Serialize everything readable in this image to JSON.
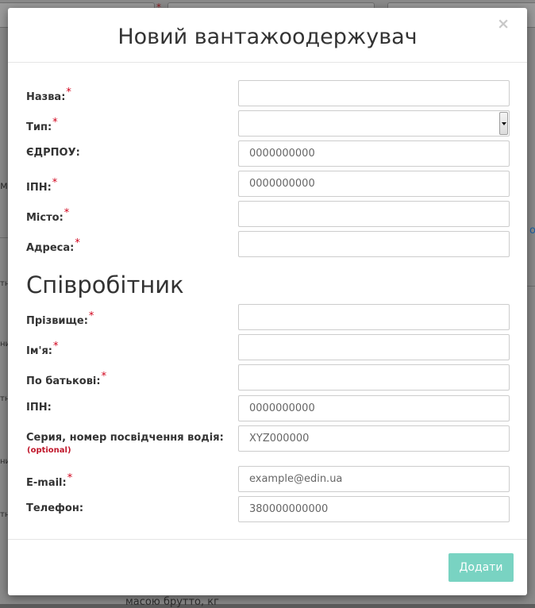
{
  "background": {
    "fragments": [
      "м",
      "о",
      "тн",
      "ни",
      "тн",
      "ни",
      "тн"
    ],
    "footer_text": "масою брутто, кг"
  },
  "modal": {
    "title": "Новий вантажоодержувач",
    "close_label": "×",
    "required_mark": "*",
    "fields": [
      {
        "label": "Назва:",
        "required": true,
        "value": "",
        "placeholder": ""
      },
      {
        "label": "Тип:",
        "required": true,
        "value": "",
        "placeholder": ""
      },
      {
        "label": "ЄДРПОУ:",
        "required": false,
        "value": "",
        "placeholder": "0000000000"
      },
      {
        "label": "ІПН:",
        "required": true,
        "value": "",
        "placeholder": "0000000000"
      },
      {
        "label": "Місто:",
        "required": true,
        "value": "",
        "placeholder": ""
      },
      {
        "label": "Адреса:",
        "required": true,
        "value": "",
        "placeholder": ""
      }
    ],
    "employee_section": {
      "title": "Співробітник",
      "fields": [
        {
          "label": "Прізвище:",
          "required": true,
          "value": "",
          "placeholder": ""
        },
        {
          "label": "Ім'я:",
          "required": true,
          "value": "",
          "placeholder": ""
        },
        {
          "label": "По батькові:",
          "required": true,
          "value": "",
          "placeholder": ""
        },
        {
          "label": "ІПН:",
          "required": false,
          "value": "",
          "placeholder": "0000000000"
        },
        {
          "label": "Серия, номер посвідчення водія:",
          "required": false,
          "optional_note": "(optional)",
          "value": "",
          "placeholder": "XYZ000000"
        },
        {
          "label": "E-mail:",
          "required": true,
          "value": "",
          "placeholder": "example@edin.ua"
        },
        {
          "label": "Телефон:",
          "required": false,
          "value": "",
          "placeholder": "380000000000"
        }
      ]
    },
    "submit_label": "Додати"
  },
  "colors": {
    "accent_button": "#79d3c2",
    "required_mark": "#d0021b",
    "overlay": "#8a8a8a"
  }
}
